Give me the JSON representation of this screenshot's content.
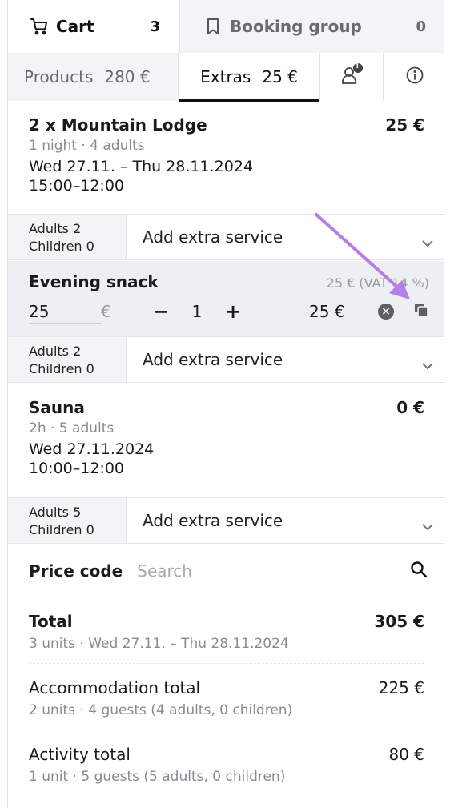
{
  "top_tabs": {
    "cart": {
      "label": "Cart",
      "count": "3"
    },
    "group": {
      "label": "Booking group",
      "count": "0"
    }
  },
  "sub_tabs": {
    "products": {
      "label": "Products",
      "amount": "280 €"
    },
    "extras": {
      "label": "Extras",
      "amount": "25 €"
    },
    "guest_badge": "!"
  },
  "products": [
    {
      "title": "2 x Mountain Lodge",
      "price": "25 €",
      "meta": "1 night  ·  4 adults",
      "dates": "Wed 27.11. – Thu 28.11.2024",
      "times": "15:00–12:00"
    },
    {
      "title": "Sauna",
      "price": "0 €",
      "meta": "2h  ·  5 adults",
      "dates": "Wed 27.11.2024",
      "times": "10:00–12:00"
    }
  ],
  "extra_rows": [
    {
      "adults": "Adults 2",
      "children": "Children 0",
      "select_label": "Add extra service"
    },
    {
      "adults": "Adults 2",
      "children": "Children 0",
      "select_label": "Add extra service"
    },
    {
      "adults": "Adults 5",
      "children": "Children 0",
      "select_label": "Add extra service"
    }
  ],
  "snack": {
    "name": "Evening snack",
    "vat_info": "25 € (VAT 14 %)",
    "unit_price": "25",
    "currency": "€",
    "minus": "−",
    "qty": "1",
    "plus": "+",
    "line_total": "25 €",
    "remove_glyph": "×"
  },
  "price_code": {
    "label": "Price code",
    "placeholder": "Search"
  },
  "totals": [
    {
      "label": "Total",
      "amount": "305 €",
      "sub": "3 units · Wed 27.11. – Thu 28.11.2024",
      "bold": true
    },
    {
      "label": "Accommodation total",
      "amount": "225 €",
      "sub": "2 units · 4 guests (4 adults, 0 children)",
      "bold": false
    },
    {
      "label": "Activity total",
      "amount": "80 €",
      "sub": "1 unit · 5 guests (5 adults, 0 children)",
      "bold": false
    }
  ],
  "colors": {
    "accent": "#111111",
    "muted": "#8a8a92",
    "annotation": "#b57ee8",
    "alt_bg": "#f4f4f6"
  },
  "icons": [
    "cart-icon",
    "bookmark-icon",
    "guest-icon",
    "info-icon",
    "chevron-down-icon",
    "remove-icon",
    "copy-icon",
    "search-icon"
  ]
}
